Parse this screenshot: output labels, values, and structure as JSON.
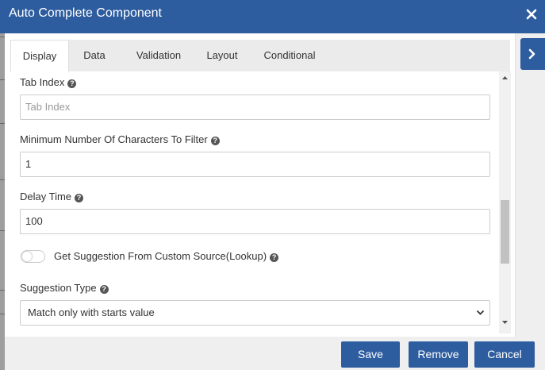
{
  "dialog": {
    "title": "Auto Complete Component",
    "close_icon": "close-icon",
    "side_icon": "chevron-right-icon"
  },
  "tabs": [
    {
      "label": "Display",
      "active": true
    },
    {
      "label": "Data",
      "active": false
    },
    {
      "label": "Validation",
      "active": false
    },
    {
      "label": "Layout",
      "active": false
    },
    {
      "label": "Conditional",
      "active": false
    }
  ],
  "fields": {
    "tab_index": {
      "label": "Tab Index",
      "value": "",
      "placeholder": "Tab Index"
    },
    "min_chars": {
      "label": "Minimum Number Of Characters To Filter",
      "value": "1"
    },
    "delay_time": {
      "label": "Delay Time",
      "value": "100"
    },
    "custom_source": {
      "label": "Get Suggestion From Custom Source(Lookup)",
      "checked": false
    },
    "suggestion_type": {
      "label": "Suggestion Type",
      "value": "Match only with starts value"
    }
  },
  "help_glyph": "?",
  "footer": {
    "save_label": "Save",
    "remove_label": "Remove",
    "cancel_label": "Cancel"
  },
  "colors": {
    "primary": "#2e5d9f",
    "background": "#efefef"
  }
}
